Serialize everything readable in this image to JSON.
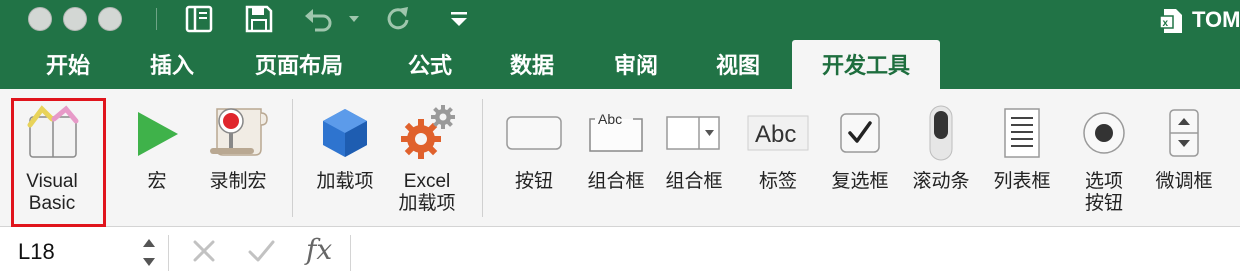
{
  "window": {
    "doc_title": "TOM",
    "traffic_lights": [
      "close",
      "minimize",
      "zoom"
    ]
  },
  "quick_access": {
    "icons": [
      "sidebar-icon",
      "save-icon",
      "undo-icon",
      "redo-icon",
      "customize-icon"
    ]
  },
  "tabs": [
    "开始",
    "插入",
    "页面布局",
    "公式",
    "数据",
    "审阅",
    "视图",
    "开发工具"
  ],
  "active_tab": "开发工具",
  "ribbon": {
    "visual_basic": "Visual Basic",
    "macros": "宏",
    "record_macro": "录制宏",
    "addins": "加载项",
    "excel_addins": "Excel 加载项",
    "button": "按钮",
    "combo_box": "组合框",
    "combo_box2": "组合框",
    "label": "标签",
    "checkbox": "复选框",
    "scroll_bar": "滚动条",
    "list_box": "列表框",
    "option_button": "选项按钮",
    "spinner": "微调框",
    "label_icon_text": "Abc",
    "groupbox_icon_text": "Abc"
  },
  "formula_bar": {
    "name_box": "L18",
    "fx": "fx",
    "formula": ""
  },
  "colors": {
    "excel_green": "#217346",
    "highlight_red": "#e0141c",
    "ribbon_bg": "#f5f5f5"
  }
}
